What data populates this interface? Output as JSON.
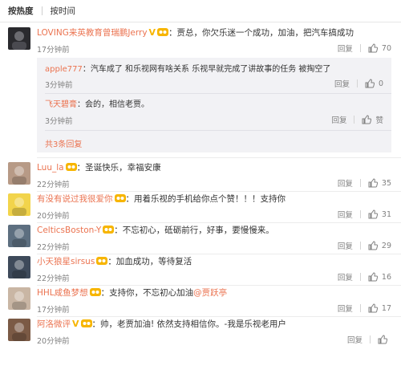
{
  "sort": {
    "hot": "按热度",
    "time": "按时间"
  },
  "main_comment": {
    "user": "LOVING来英教育曾瑞鹏Jerry",
    "v_mark": "V",
    "text": "：贾总，你欠乐迷一个成功，加油，把汽车搞成功",
    "time": "17分钟前",
    "reply": "回复",
    "likes": "70",
    "replies": [
      {
        "user": "apple777",
        "text": "：汽车成了 和乐视网有啥关系 乐视早就完成了讲故事的任务 被掏空了",
        "time": "3分钟前",
        "reply": "回复",
        "like": "0"
      },
      {
        "user": "飞天碧膏",
        "text": "：会的，相信老贾。",
        "time": "3分钟前",
        "reply": "回复",
        "like": "赞"
      }
    ],
    "more": "共3条回复"
  },
  "comments": [
    {
      "user": "Luu_la",
      "text": "：圣诞快乐，幸福安康",
      "time": "22分钟前",
      "reply": "回复",
      "likes": "35",
      "avatar_color": "#b79a86"
    },
    {
      "user": "有没有说过我很爱你",
      "text": "：用着乐视的手机给你点个赞！！！支持你",
      "time": "20分钟前",
      "reply": "回复",
      "likes": "31",
      "avatar_color": "#f2d44b"
    },
    {
      "user": "CelticsBoston-Y",
      "text": "：不忘初心，砥砺前行，好事，要慢慢来。",
      "time": "22分钟前",
      "reply": "回复",
      "likes": "29",
      "avatar_color": "#5d6f80"
    },
    {
      "user": "小天狼星sirsus",
      "text": "：加血成功，等待复活",
      "time": "22分钟前",
      "reply": "回复",
      "likes": "16",
      "avatar_color": "#3e4a5a"
    },
    {
      "user": "HHL咸鱼梦想",
      "text": "：支持你，不忘初心加油",
      "mention": "@贾跃亭",
      "time": "17分钟前",
      "reply": "回复",
      "likes": "17",
      "avatar_color": "#c9b6a4"
    },
    {
      "user": "阿洛微评",
      "v_mark": "V",
      "text": "：帅，老贾加油! 依然支持相信你。-我是乐视老用户",
      "time": "20分钟前",
      "reply": "回复",
      "likes": "",
      "avatar_color": "#7b5a45"
    }
  ],
  "colors": {
    "username": "#eb7350",
    "meta": "#808080",
    "vip_badge": "#f7b500",
    "reply_bg": "#f2f2f5"
  }
}
